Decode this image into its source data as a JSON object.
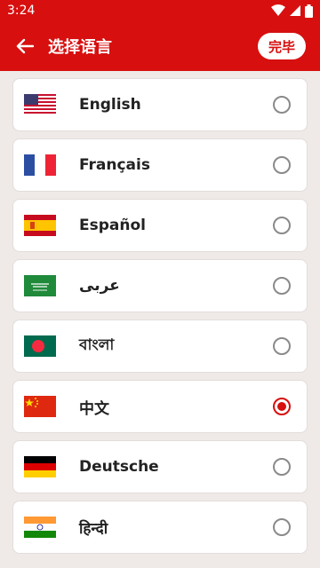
{
  "status": {
    "time": "3:24"
  },
  "app_bar": {
    "title": "选择语言",
    "done_label": "完毕"
  },
  "languages": [
    {
      "label": "English",
      "flag": "us-flag-icon",
      "selected": false
    },
    {
      "label": "Français",
      "flag": "france-flag-icon",
      "selected": false
    },
    {
      "label": "Español",
      "flag": "spain-flag-icon",
      "selected": false
    },
    {
      "label": "عربى",
      "flag": "saudi-flag-icon",
      "selected": false
    },
    {
      "label": "বাংলা",
      "flag": "bangladesh-flag-icon",
      "selected": false
    },
    {
      "label": "中文",
      "flag": "china-flag-icon",
      "selected": true
    },
    {
      "label": "Deutsche",
      "flag": "germany-flag-icon",
      "selected": false
    },
    {
      "label": "हिन्दी",
      "flag": "india-flag-icon",
      "selected": false
    }
  ],
  "colors": {
    "primary": "#d70f0f",
    "background": "#efeae8"
  }
}
